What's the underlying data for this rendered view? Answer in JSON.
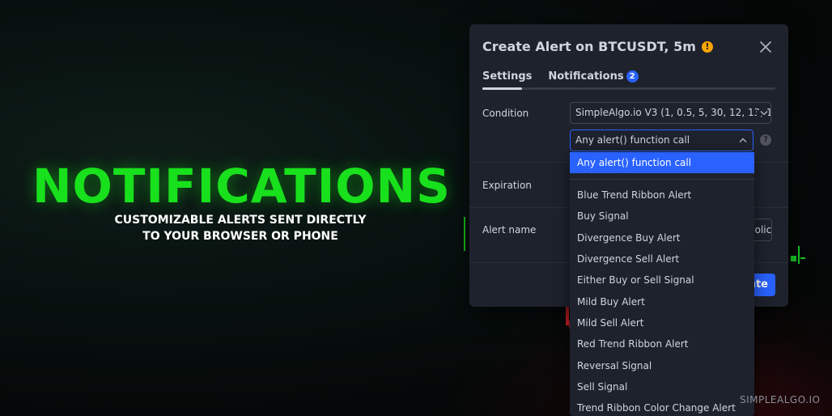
{
  "hero": {
    "title": "NOTIFICATIONS",
    "subtitle_line1": "CUSTOMIZABLE ALERTS SENT DIRECTLY",
    "subtitle_line2": "TO YOUR BROWSER OR PHONE"
  },
  "dialog": {
    "title": "Create Alert on BTCUSDT, 5m",
    "warning_icon": "!",
    "tabs": [
      {
        "label": "Settings",
        "active": true
      },
      {
        "label": "Notifications",
        "badge": "2",
        "active": false
      }
    ],
    "condition_label": "Condition",
    "condition_value": "SimpleAlgo.io V3 (1, 0.5, 5, 30, 12, 13, 1...",
    "trigger_value": "Any alert() function call",
    "help_icon": "?",
    "expiration_label": "Expiration",
    "alert_name_label": "Alert name",
    "alert_name_value_partial": "Solic",
    "create_button_partial": "ate"
  },
  "dropdown": {
    "selected": "Any alert() function call",
    "items": [
      "Blue Trend Ribbon Alert",
      "Buy Signal",
      "Divergence Buy Alert",
      "Divergence Sell Alert",
      "Either Buy or Sell Signal",
      "Mild Buy Alert",
      "Mild Sell Alert",
      "Red Trend Ribbon Alert",
      "Reversal Signal",
      "Sell Signal",
      "Trend Ribbon Color Change Alert"
    ]
  },
  "watermark": "SIMPLEALGO.IO",
  "colors": {
    "accent_green": "#19e01c",
    "dialog_bg": "#1e222d",
    "primary_blue": "#2962ff",
    "warning": "#f7a600"
  }
}
